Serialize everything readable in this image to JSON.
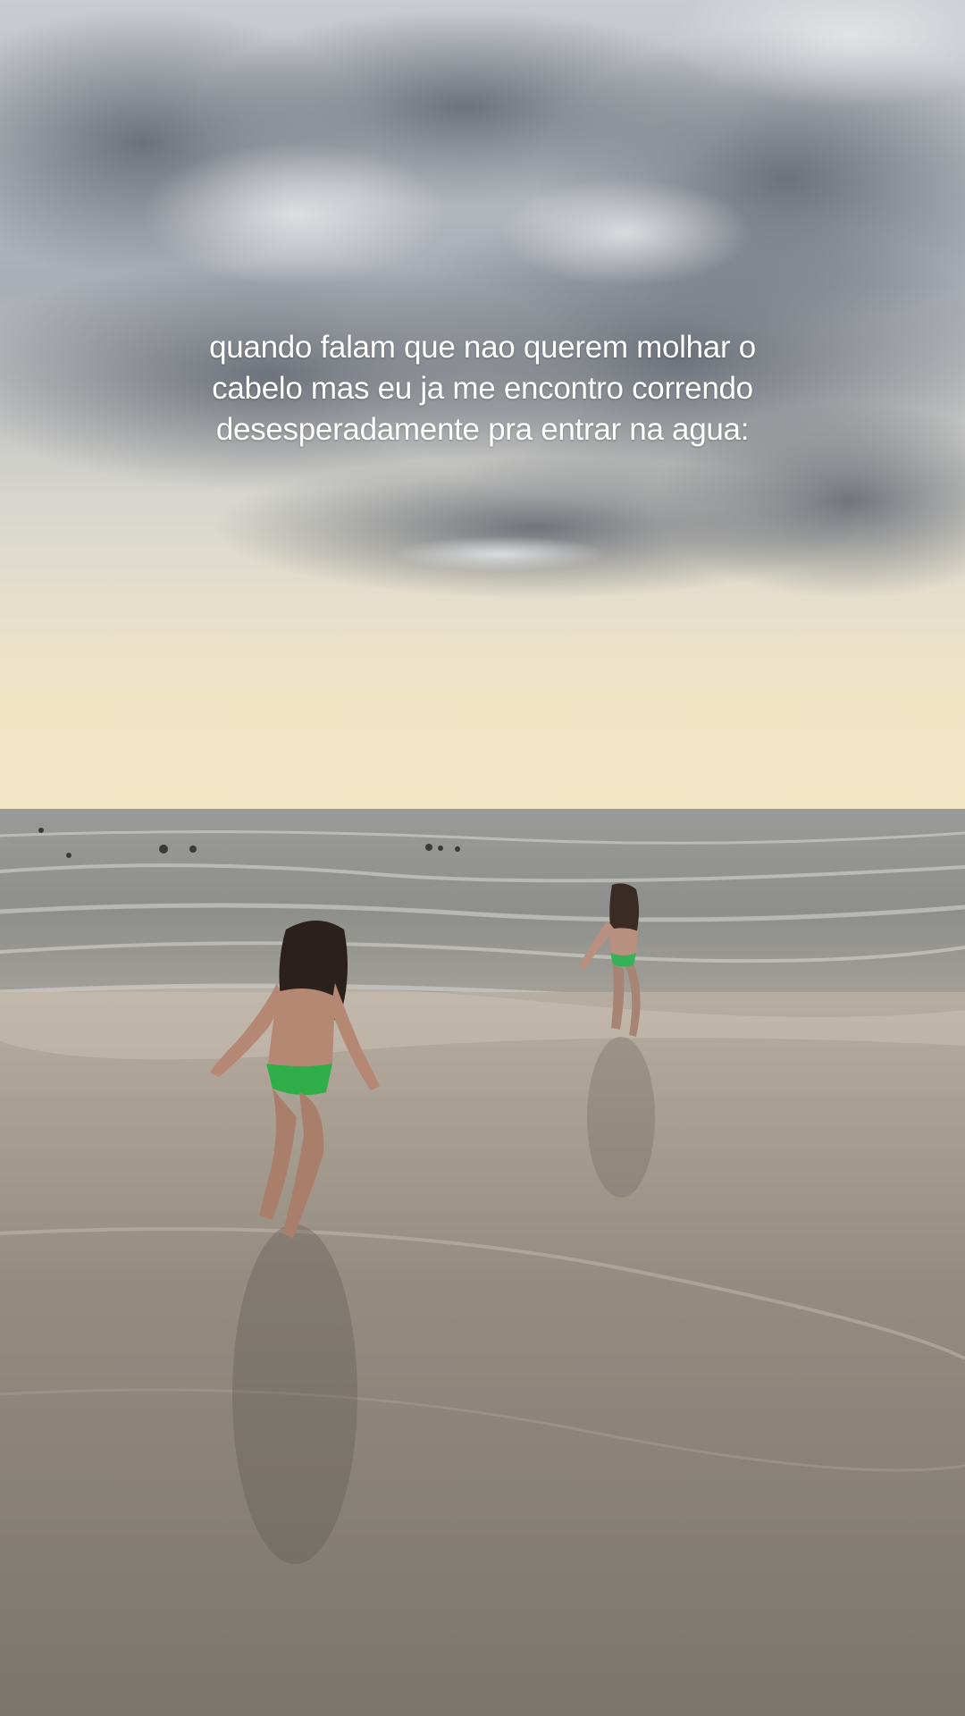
{
  "video": {
    "caption_lines": [
      "quando falam que nao querem molhar o",
      "cabelo mas eu ja me encontro correndo",
      "desesperadamente pra entrar na agua:"
    ],
    "scene_description_colors": {
      "sky_top": "#b9bcc2",
      "cloud_dark": "#6b7079",
      "horizon_glow": "#efe2c4",
      "sea": "#8d8e8a",
      "sand_wet": "#8a837a",
      "swimsuit": "#2bb24c"
    }
  }
}
